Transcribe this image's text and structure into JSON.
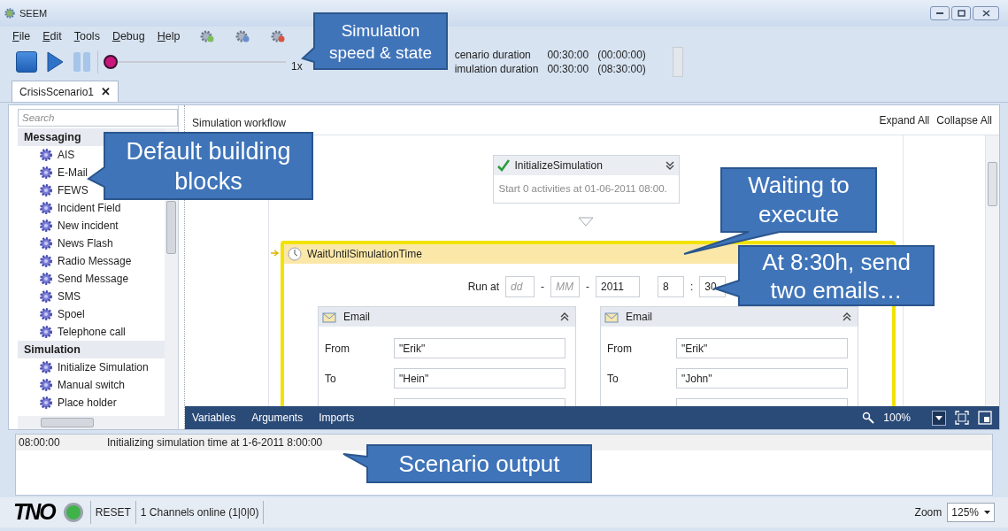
{
  "window": {
    "title": "SEEM"
  },
  "menu": [
    "File",
    "Edit",
    "Tools",
    "Debug",
    "Help"
  ],
  "toolbar": {
    "stop": {
      "disabled": false
    },
    "play": {
      "disabled": false
    },
    "pause": {
      "disabled": true
    },
    "speed": {
      "level": 0,
      "reading": "1x"
    }
  },
  "durations": [
    {
      "label": "cenario duration",
      "value": "00:30:00",
      "elapsed": "(00:00:00)"
    },
    {
      "label": "imulation duration",
      "value": "00:30:00",
      "elapsed": "(08:30:00)"
    }
  ],
  "document_tabs": [
    {
      "label": "CrisisScenario1",
      "close": "✕",
      "selected": true
    }
  ],
  "toolbox": {
    "placeholder": "Search",
    "categories": [
      {
        "name": "Messaging",
        "items": [
          "AIS",
          "E-Mail",
          "FEWS",
          "Incident Field",
          "New incident",
          "News Flash",
          "Radio Message",
          "Send Message",
          "SMS",
          "Spoel",
          "Telephone call"
        ]
      },
      {
        "name": "Simulation",
        "items": [
          "Initialize Simulation",
          "Manual switch",
          "Place holder"
        ]
      }
    ]
  },
  "designer": {
    "title": "Simulation workflow",
    "actions": [
      "Expand All",
      "Collapse All"
    ],
    "activities": [
      {
        "kind": "done",
        "title": "InitializeSimulation",
        "summary": "Start 0 activities at 01-06-2011 08:00."
      },
      {
        "kind": "waiting",
        "title": "WaitUntilSimulationTime",
        "run_at": {
          "label": "Run at",
          "day_placeholder": "dd",
          "month_placeholder": "MM",
          "year": "2011",
          "hour": "8",
          "minute": "30",
          "date_separator": "-",
          "time_separator": ":"
        },
        "emails": [
          {
            "title": "Email",
            "fields": [
              {
                "label": "From",
                "value": "\"Erik\""
              },
              {
                "label": "To",
                "value": "\"Hein\""
              }
            ]
          },
          {
            "title": "Email",
            "fields": [
              {
                "label": "From",
                "value": "\"Erik\""
              },
              {
                "label": "To",
                "value": "\"John\""
              }
            ]
          }
        ]
      }
    ],
    "bottom_tabs": [
      "Variables",
      "Arguments",
      "Imports"
    ],
    "zoom": "100%"
  },
  "output": [
    {
      "time": "08:00:00",
      "message": "Initializing simulation time at 1-6-2011 8:00:00"
    }
  ],
  "status_bar": {
    "logo": "TNO",
    "online": true,
    "reset": "RESET",
    "channels": "1 Channels online (1|0|0)",
    "zoom_label": "Zoom",
    "zoom": "125%"
  },
  "callouts": [
    {
      "text": "Simulation speed & state"
    },
    {
      "text": "Default building blocks"
    },
    {
      "text": "Waiting to execute"
    },
    {
      "text": "At 8:30h, send two emails…"
    },
    {
      "text": "Scenario output"
    }
  ]
}
